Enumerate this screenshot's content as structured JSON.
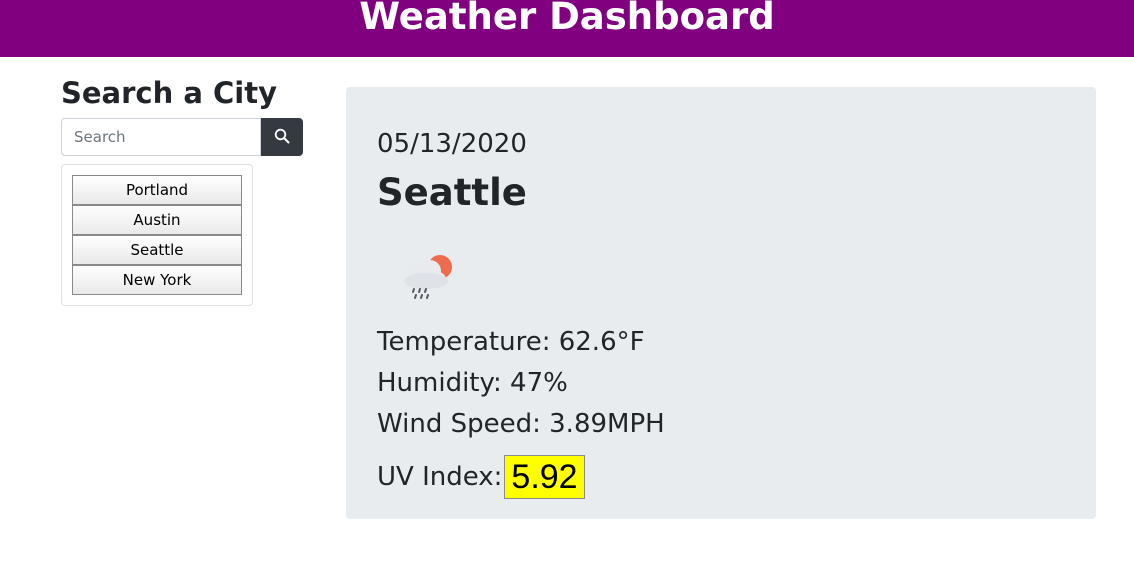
{
  "header": {
    "title": "Weather Dashboard"
  },
  "sidebar": {
    "title": "Search a City",
    "search": {
      "placeholder": "Search",
      "value": "",
      "button_icon": "search-icon"
    },
    "cities": [
      "Portland",
      "Austin",
      "Seattle",
      "New York"
    ]
  },
  "current": {
    "date": "05/13/2020",
    "city": "Seattle",
    "icon": "cloud-rain-sun-icon",
    "temperature_label": "Temperature: 62.6°F",
    "humidity_label": "Humidity: 47%",
    "wind_label": "Wind Speed: 3.89MPH",
    "uv_label": "UV Index:",
    "uv_value": "5.92",
    "uv_color": "#ffff00"
  },
  "colors": {
    "header_bg": "#800080",
    "card_bg": "#e9ecef",
    "search_button_bg": "#343a40"
  }
}
